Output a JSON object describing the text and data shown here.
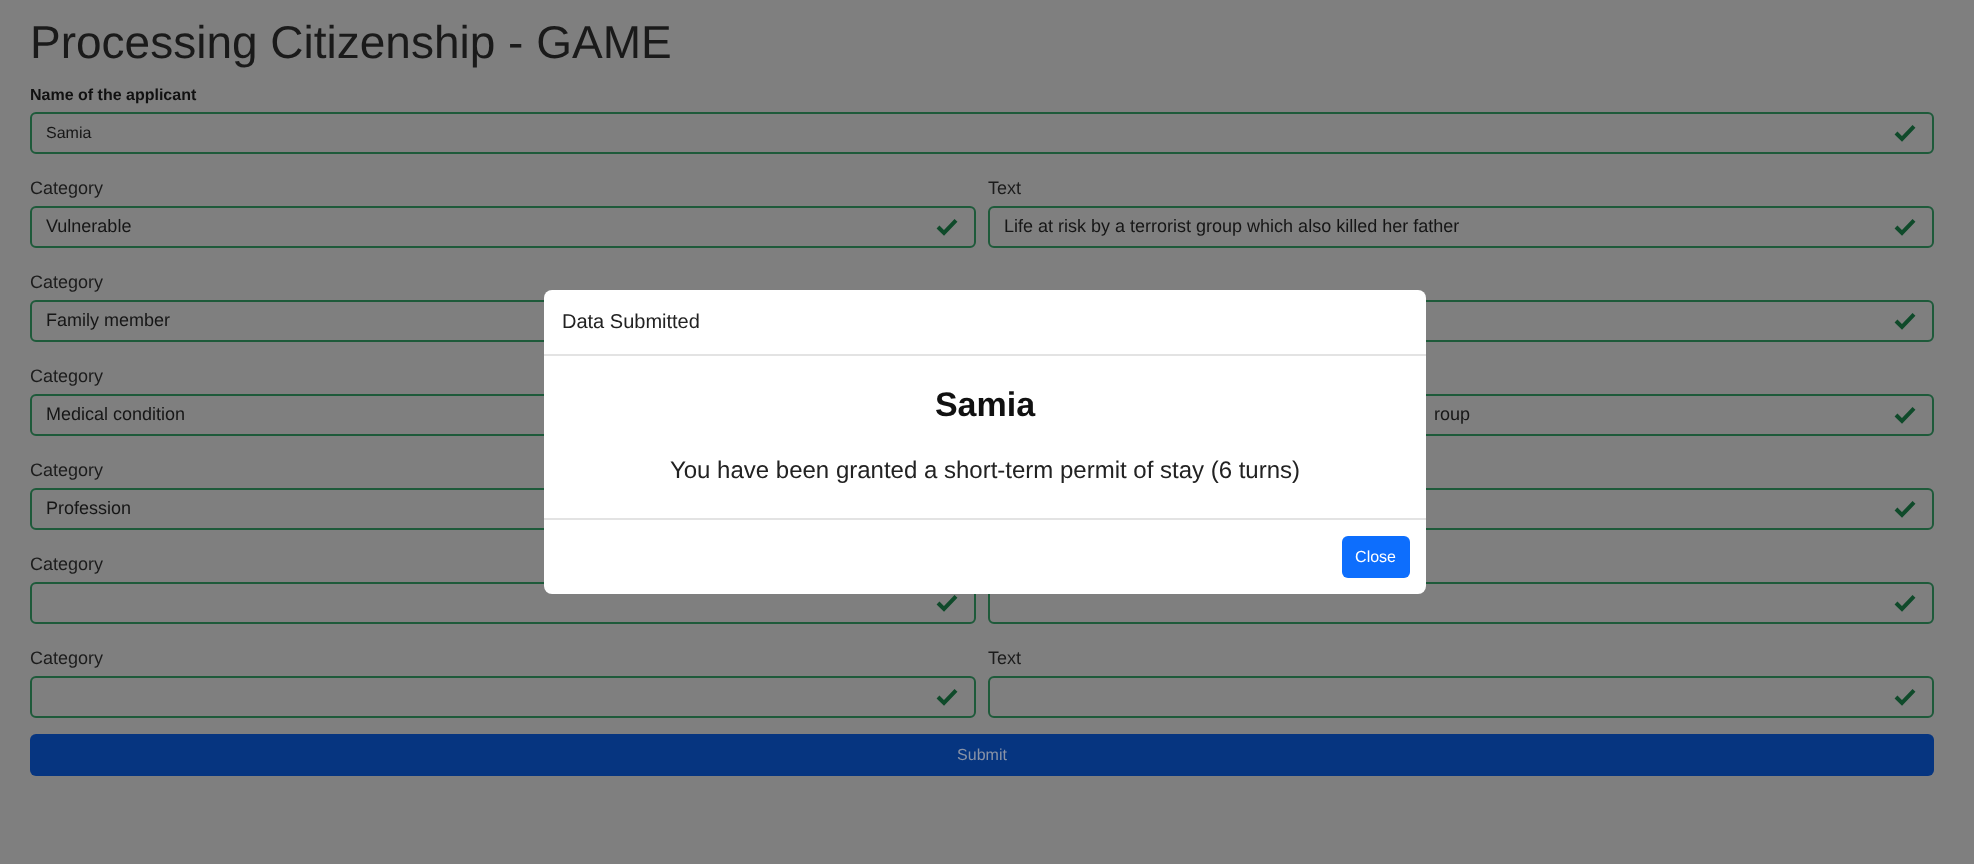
{
  "page": {
    "title": "Processing Citizenship - GAME"
  },
  "applicant": {
    "label": "Name of the applicant",
    "value": "Samia",
    "valid": true
  },
  "rows": [
    {
      "category": {
        "label": "Category",
        "value": "Vulnerable",
        "valid": true
      },
      "text": {
        "label": "Text",
        "value": "Life at risk by a terrorist group which also killed her father",
        "valid": true
      }
    },
    {
      "category": {
        "label": "Category",
        "value": "Family member",
        "valid": true,
        "check_covered": true
      },
      "text": {
        "valid": true
      }
    },
    {
      "category": {
        "label": "Category",
        "value": "Medical condition",
        "valid": true,
        "check_covered": true
      },
      "text": {
        "value": "roup",
        "covered_left": true,
        "valid": true
      }
    },
    {
      "category": {
        "label": "Category",
        "value": "Profession",
        "valid": true,
        "check_covered": true
      },
      "text": {
        "valid": true
      }
    },
    {
      "category": {
        "label": "Category",
        "valid": true
      },
      "text": {
        "valid": true
      }
    },
    {
      "category": {
        "label": "Category",
        "valid": true
      },
      "text": {
        "label": "Text",
        "valid": true
      }
    }
  ],
  "submit": {
    "label": "Submit"
  },
  "modal": {
    "title": "Data Submitted",
    "heading": "Samia",
    "message": "You have been granted a short-term permit of stay (6 turns)",
    "close": "Close"
  }
}
